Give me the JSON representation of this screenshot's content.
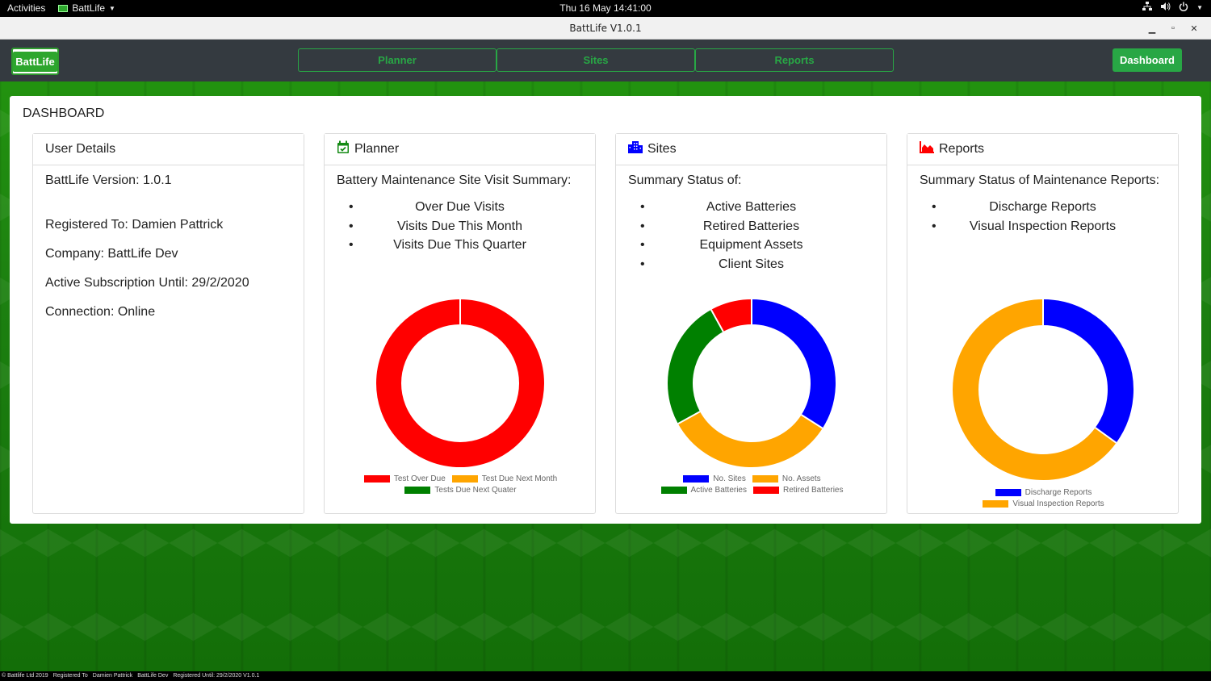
{
  "topbar": {
    "activities": "Activities",
    "app_name": "BattLife",
    "clock": "Thu 16 May  14:41:00"
  },
  "window": {
    "title": "BattLife V1.0.1"
  },
  "navbar": {
    "logo": "BattLife",
    "planner": "Planner",
    "sites": "Sites",
    "reports": "Reports",
    "dashboard": "Dashboard"
  },
  "dashboard": {
    "title": "DASHBOARD",
    "user": {
      "heading": "User Details",
      "version": "BattLife Version: 1.0.1",
      "registered": "Registered To: Damien Pattrick",
      "company": "Company: BattLife Dev",
      "subscription": "Active Subscription Until: 29/2/2020",
      "connection": "Connection: Online"
    },
    "planner": {
      "heading": "Planner",
      "subtitle": "Battery Maintenance Site Visit Summary:",
      "items": [
        "Over Due Visits",
        "Visits Due This Month",
        "Visits Due This Quarter"
      ]
    },
    "sites": {
      "heading": "Sites",
      "subtitle": "Summary Status of:",
      "items": [
        "Active Batteries",
        "Retired Batteries",
        "Equipment Assets",
        "Client Sites"
      ]
    },
    "reports": {
      "heading": "Reports",
      "subtitle": "Summary Status of Maintenance Reports:",
      "items": [
        "Discharge Reports",
        "Visual Inspection Reports"
      ]
    }
  },
  "colors": {
    "red": "#ff0000",
    "orange": "#ffa500",
    "green": "#008000",
    "blue": "#0000ff",
    "accent": "#28a745"
  },
  "chart_data": [
    {
      "type": "pie",
      "categories": [
        "Test Over Due",
        "Test Due Next Month",
        "Tests Due Next Quater"
      ],
      "values": [
        100,
        0,
        0
      ],
      "colors": [
        "#ff0000",
        "#ffa500",
        "#008000"
      ]
    },
    {
      "type": "pie",
      "categories": [
        "No. Sites",
        "No. Assets",
        "Active Batteries",
        "Retired Batteries"
      ],
      "values": [
        34,
        33,
        25,
        8
      ],
      "colors": [
        "#0000ff",
        "#ffa500",
        "#008000",
        "#ff0000"
      ]
    },
    {
      "type": "pie",
      "categories": [
        "Discharge Reports",
        "Visual Inspection Reports"
      ],
      "values": [
        35,
        65
      ],
      "colors": [
        "#0000ff",
        "#ffa500"
      ]
    }
  ],
  "statusbar": {
    "copyright": "© Battlife Ltd 2019",
    "registered_label": "Registered To",
    "user": "Damien Pattrick",
    "company": "BattLife Dev",
    "until": "Registered Until: 29/2/2020 V1.0.1"
  }
}
